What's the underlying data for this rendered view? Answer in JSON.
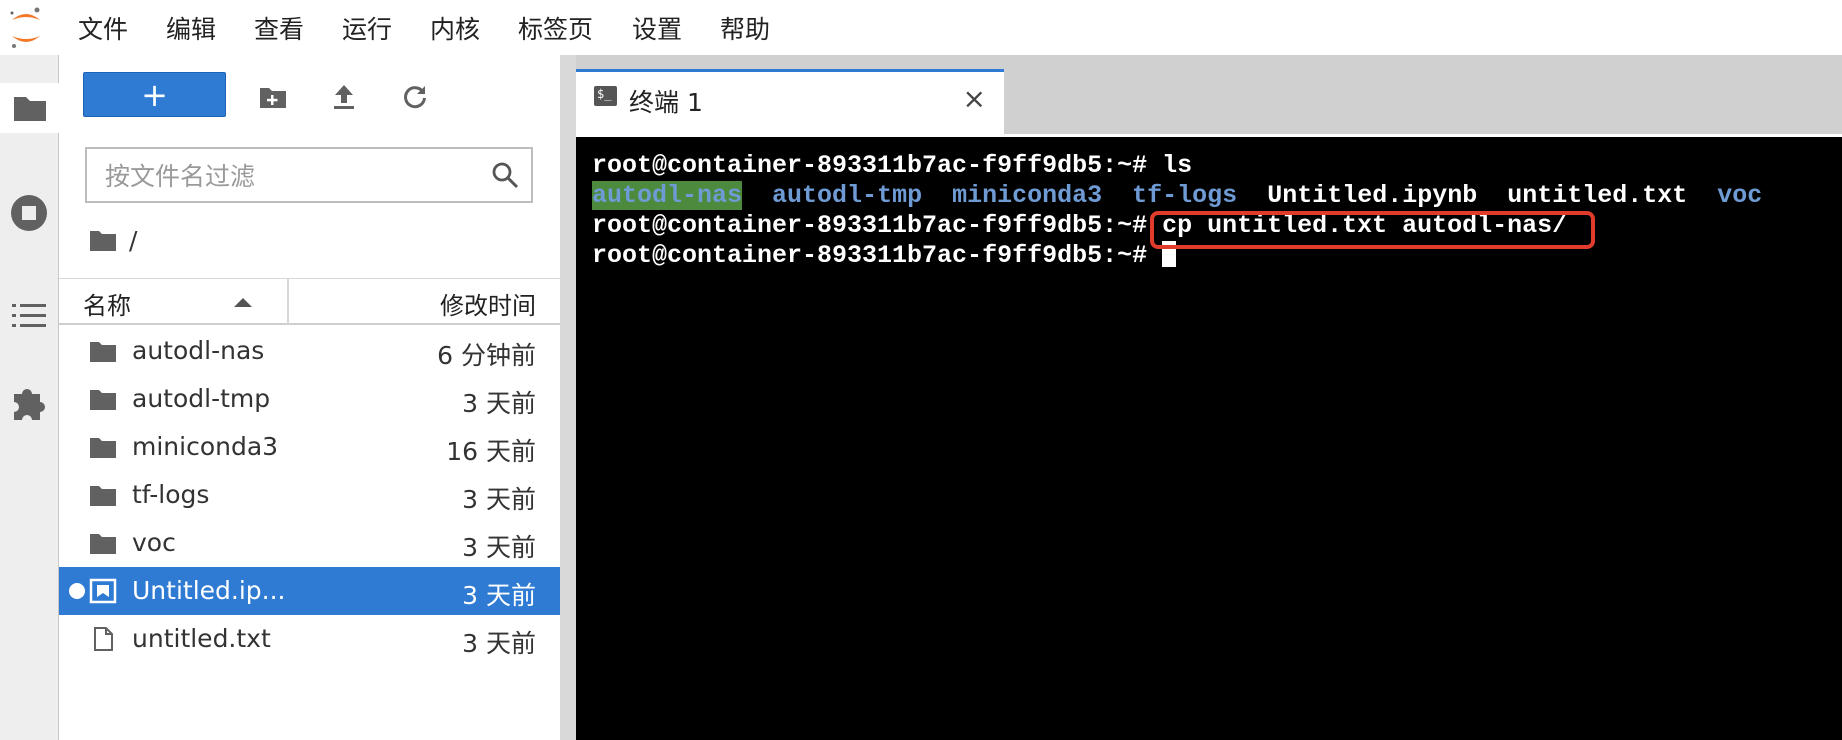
{
  "menu": {
    "items": [
      "文件",
      "编辑",
      "查看",
      "运行",
      "内核",
      "标签页",
      "设置",
      "帮助"
    ]
  },
  "sidebar": {
    "icons": [
      "folder-icon",
      "stop-circle-icon",
      "list-icon",
      "puzzle-icon"
    ]
  },
  "filebrowser": {
    "new_label": "+",
    "filter_placeholder": "按文件名过滤",
    "breadcrumb": "/",
    "columns": {
      "name": "名称",
      "modified": "修改时间"
    },
    "files": [
      {
        "name": "autodl-nas",
        "modified": "6 分钟前",
        "type": "folder"
      },
      {
        "name": "autodl-tmp",
        "modified": "3 天前",
        "type": "folder"
      },
      {
        "name": "miniconda3",
        "modified": "16 天前",
        "type": "folder"
      },
      {
        "name": "tf-logs",
        "modified": "3 天前",
        "type": "folder"
      },
      {
        "name": "voc",
        "modified": "3 天前",
        "type": "folder"
      },
      {
        "name": "Untitled.ip...",
        "modified": "3 天前",
        "type": "notebook",
        "selected": true
      },
      {
        "name": "untitled.txt",
        "modified": "3 天前",
        "type": "file"
      }
    ]
  },
  "tab": {
    "label": "终端 1",
    "icon_text": "$_",
    "close": "×"
  },
  "terminal": {
    "prompt": "root@container-893311b7ac-f9ff9db5:~# ",
    "line1_cmd": "ls",
    "ls_output": {
      "dir1": "autodl-nas",
      "dir2": "autodl-tmp",
      "dir3": "miniconda3",
      "dir4": "tf-logs",
      "file1": "Untitled.ipynb",
      "file2": "untitled.txt",
      "dir5": "voc"
    },
    "line3_cmd": "cp untitled.txt autodl-nas/",
    "colors": {
      "dir": "#6f9bd4",
      "highlight_bg": "#4d8a3e",
      "annotation": "#e03b2b"
    }
  }
}
